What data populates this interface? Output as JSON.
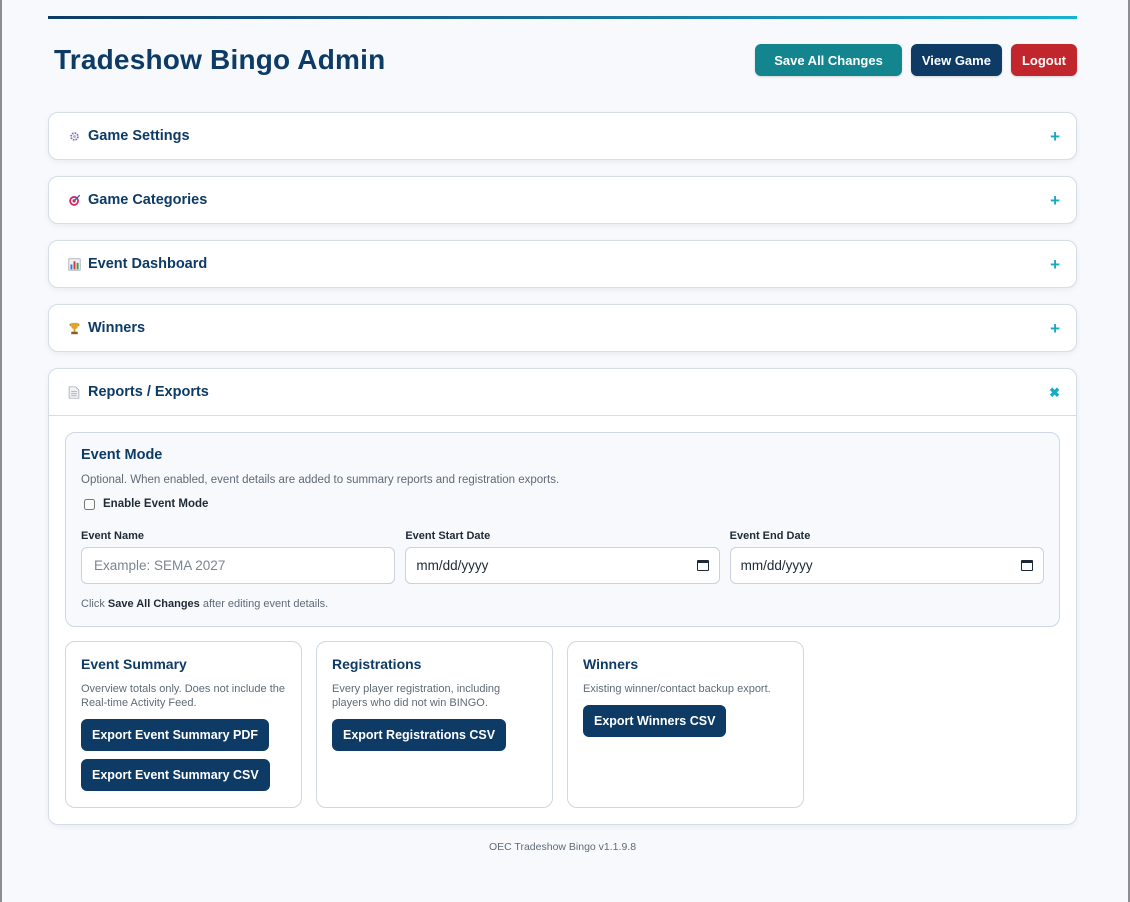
{
  "header": {
    "title": "Tradeshow Bingo Admin",
    "save_label": "Save All Changes",
    "view_label": "View Game",
    "logout_label": "Logout"
  },
  "sections": [
    {
      "label": "Game Settings",
      "icon": "gear-icon",
      "toggle": "+"
    },
    {
      "label": "Game Categories",
      "icon": "target-icon",
      "toggle": "+"
    },
    {
      "label": "Event Dashboard",
      "icon": "bar-chart-icon",
      "toggle": "+"
    },
    {
      "label": "Winners",
      "icon": "trophy-icon",
      "toggle": "+"
    },
    {
      "label": "Reports / Exports",
      "icon": "document-icon",
      "toggle": "✖"
    }
  ],
  "event_mode": {
    "title": "Event Mode",
    "description": "Optional. When enabled, event details are added to summary reports and registration exports.",
    "checkbox_label": "Enable Event Mode",
    "checked": false,
    "name_label": "Event Name",
    "name_placeholder": "Example: SEMA 2027",
    "start_label": "Event Start Date",
    "start_value": "mm/dd/yyyy",
    "end_label": "Event End Date",
    "end_value": "mm/dd/yyyy",
    "hint_prefix": "Click ",
    "hint_bold": "Save All Changes",
    "hint_suffix": " after editing event details."
  },
  "exports": [
    {
      "title": "Event Summary",
      "description": "Overview totals only. Does not include the Real-time Activity Feed.",
      "buttons": [
        "Export Event Summary PDF",
        "Export Event Summary CSV"
      ]
    },
    {
      "title": "Registrations",
      "description": "Every player registration, including players who did not win BINGO.",
      "buttons": [
        "Export Registrations CSV"
      ]
    },
    {
      "title": "Winners",
      "description": "Existing winner/contact backup export.",
      "buttons": [
        "Export Winners CSV"
      ]
    }
  ],
  "footer": "OEC Tradeshow Bingo v1.1.9.8",
  "colors": {
    "navy": "#0d3b66",
    "teal": "#13858f",
    "red": "#c0262b",
    "accent": "#17a9c8"
  }
}
